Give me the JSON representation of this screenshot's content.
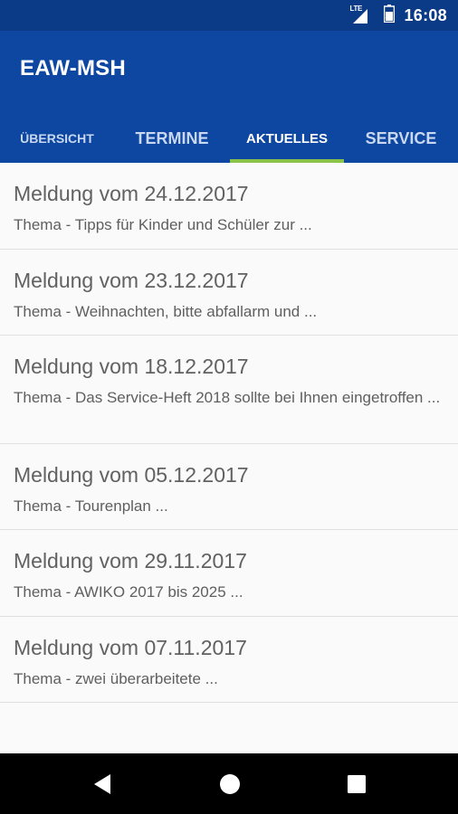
{
  "status_bar": {
    "network": "LTE",
    "time": "16:08",
    "icons": [
      "lte-signal-icon",
      "battery-icon"
    ]
  },
  "app": {
    "title": "EAW-MSH",
    "colors": {
      "primary": "#0d47a1",
      "status": "#0b3a86",
      "indicator": "#8bc34a"
    }
  },
  "tabs": [
    {
      "label": "ÜBERSICHT",
      "active": false
    },
    {
      "label": "TERMINE",
      "active": false
    },
    {
      "label": "AKTUELLES",
      "active": true
    },
    {
      "label": "SERVICE",
      "active": false
    }
  ],
  "news": [
    {
      "title": "Meldung vom 24.12.2017",
      "subtitle": "Thema - Tipps für Kinder und Schüler zur ..."
    },
    {
      "title": "Meldung vom 23.12.2017",
      "subtitle": "Thema - Weihnachten, bitte abfallarm und ..."
    },
    {
      "title": "Meldung vom 18.12.2017",
      "subtitle": "Thema - Das Service-Heft 2018 sollte bei Ihnen eingetroffen ..."
    },
    {
      "title": "Meldung vom 05.12.2017",
      "subtitle": "Thema - Tourenplan ..."
    },
    {
      "title": "Meldung vom 29.11.2017",
      "subtitle": "Thema - AWIKO 2017 bis 2025 ..."
    },
    {
      "title": "Meldung vom 07.11.2017",
      "subtitle": "Thema - zwei überarbeitete ..."
    }
  ],
  "nav_bar": {
    "icons": [
      "back-icon",
      "home-icon",
      "recents-icon"
    ]
  }
}
